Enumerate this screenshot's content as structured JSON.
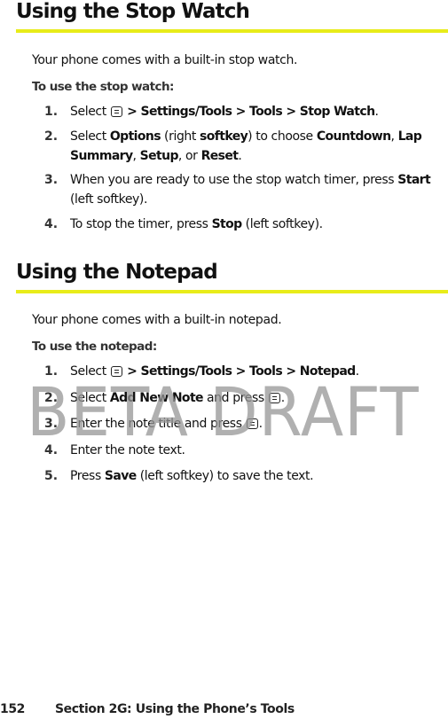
{
  "sections": [
    {
      "title": "Using the Stop Watch",
      "intro": "Your phone comes with a built-in stop watch.",
      "label": "To use the stop watch:",
      "steps": [
        {
          "num": "1.",
          "parts": [
            {
              "t": "Select "
            },
            {
              "icon": "menu-ok-key-icon"
            },
            {
              "t": " > Settings/Tools > Tools > Stop Watch",
              "b": true
            },
            {
              "t": "."
            }
          ]
        },
        {
          "num": "2.",
          "parts": [
            {
              "t": "Select "
            },
            {
              "t": "Options",
              "b": true
            },
            {
              "t": " (right "
            },
            {
              "t": "softkey",
              "b": true
            },
            {
              "t": ") to choose "
            },
            {
              "t": "Countdown",
              "b": true
            },
            {
              "t": ", "
            },
            {
              "t": "Lap Summary",
              "b": true
            },
            {
              "t": ", "
            },
            {
              "t": "Setup",
              "b": true
            },
            {
              "t": ", or "
            },
            {
              "t": "Reset",
              "b": true
            },
            {
              "t": "."
            }
          ]
        },
        {
          "num": "3.",
          "parts": [
            {
              "t": "When you are ready to use the stop watch timer, press "
            },
            {
              "t": "Start",
              "b": true
            },
            {
              "t": " (left softkey)."
            }
          ]
        },
        {
          "num": "4.",
          "parts": [
            {
              "t": "To stop the timer, press "
            },
            {
              "t": "Stop",
              "b": true
            },
            {
              "t": " (left softkey)."
            }
          ]
        }
      ]
    },
    {
      "title": "Using the Notepad",
      "intro": "Your phone comes with a built-in notepad.",
      "label": "To use the notepad:",
      "steps": [
        {
          "num": "1.",
          "parts": [
            {
              "t": "Select "
            },
            {
              "icon": "menu-ok-key-icon"
            },
            {
              "t": " > Settings/Tools > Tools > Notepad",
              "b": true
            },
            {
              "t": "."
            }
          ]
        },
        {
          "num": "2.",
          "parts": [
            {
              "t": "Select "
            },
            {
              "t": "Add New Note",
              "b": true
            },
            {
              "t": " and press "
            },
            {
              "icon": "menu-ok-key-icon"
            },
            {
              "t": "."
            }
          ]
        },
        {
          "num": "3.",
          "parts": [
            {
              "t": "Enter the note title and press "
            },
            {
              "icon": "menu-ok-key-icon"
            },
            {
              "t": "."
            }
          ]
        },
        {
          "num": "4.",
          "parts": [
            {
              "t": "Enter the note text."
            }
          ]
        },
        {
          "num": "5.",
          "parts": [
            {
              "t": "Press "
            },
            {
              "t": "Save",
              "b": true
            },
            {
              "t": " (left softkey) to save the text."
            }
          ]
        }
      ]
    }
  ],
  "watermark": "BETA DRAFT",
  "footer": {
    "page_number": "152",
    "section": "Section 2G: Using the Phone’s Tools"
  },
  "colors": {
    "accent_rule": "#e8ec1a",
    "watermark": "#969696"
  }
}
